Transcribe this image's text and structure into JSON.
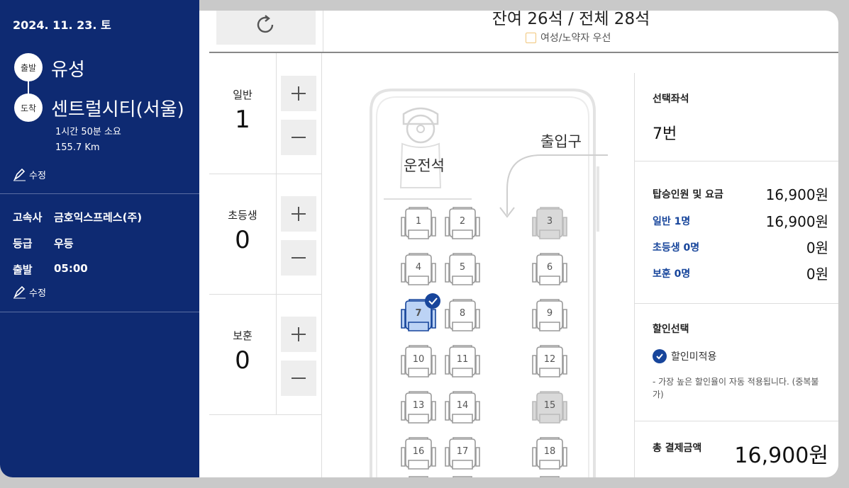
{
  "sidebar": {
    "date": "2024. 11. 23. 토",
    "departure_badge": "출발",
    "departure": "유성",
    "arrival_badge": "도착",
    "arrival": "센트럴시티(서울)",
    "duration": "1시간 50분 소요",
    "distance": "155.7 Km",
    "edit_label": "수정",
    "company_key": "고속사",
    "company": "금호익스프레스(주)",
    "grade_key": "등급",
    "grade": "우등",
    "time_key": "출발",
    "time": "05:00",
    "edit_label2": "수정"
  },
  "header": {
    "remaining": "잔여 26석 / 전체 28석",
    "preference": "여성/노약자 우선"
  },
  "counters": [
    {
      "label": "일반",
      "value": "1"
    },
    {
      "label": "초등생",
      "value": "0"
    },
    {
      "label": "보훈",
      "value": "0"
    }
  ],
  "bus": {
    "driver_label": "운전석",
    "entrance_label": "출입구",
    "seats": [
      {
        "no": "1",
        "state": "available"
      },
      {
        "no": "2",
        "state": "available"
      },
      {
        "no": "3",
        "state": "taken"
      },
      {
        "no": "4",
        "state": "available"
      },
      {
        "no": "5",
        "state": "available"
      },
      {
        "no": "6",
        "state": "available"
      },
      {
        "no": "7",
        "state": "selected"
      },
      {
        "no": "8",
        "state": "available"
      },
      {
        "no": "9",
        "state": "available"
      },
      {
        "no": "10",
        "state": "available"
      },
      {
        "no": "11",
        "state": "available"
      },
      {
        "no": "12",
        "state": "available"
      },
      {
        "no": "13",
        "state": "available"
      },
      {
        "no": "14",
        "state": "available"
      },
      {
        "no": "15",
        "state": "taken"
      },
      {
        "no": "16",
        "state": "available"
      },
      {
        "no": "17",
        "state": "available"
      },
      {
        "no": "18",
        "state": "available"
      }
    ]
  },
  "summary": {
    "selected_title": "선택좌석",
    "selected_seat": "7번",
    "fare_title": "탑승인원 및 요금",
    "fare_total": "16,900원",
    "general_label": "일반 1명",
    "general_amount": "16,900원",
    "child_label": "초등생 0명",
    "child_amount": "0원",
    "veteran_label": "보훈 0명",
    "veteran_amount": "0원",
    "discount_title": "할인선택",
    "discount_option": "할인미적용",
    "discount_note": "- 가장 높은 할인율이 자동 적용됩니다. (중복불가)",
    "total_label": "총 결제금액",
    "total_amount": "16,900원"
  },
  "colors": {
    "navy": "#0e2a72",
    "accent": "#17459b",
    "selected_fill": "#bcd3f5",
    "taken_fill": "#d9d9d9"
  }
}
